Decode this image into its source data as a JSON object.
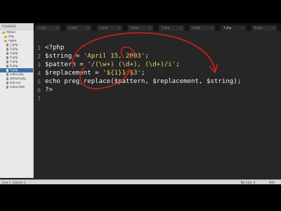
{
  "sidebar": {
    "header": "FOLDERS",
    "items": [
      {
        "label": "htdocs",
        "type": "folder"
      },
      {
        "label": "img",
        "type": "folder"
      },
      {
        "label": "regex",
        "type": "folder"
      },
      {
        "label": "1.php",
        "type": "file"
      },
      {
        "label": "2.php",
        "type": "file"
      },
      {
        "label": "3.php",
        "type": "file"
      },
      {
        "label": "4.php",
        "type": "file"
      },
      {
        "label": "5.php",
        "type": "file"
      },
      {
        "label": "6.php",
        "type": "file"
      },
      {
        "label": "7.php",
        "type": "file",
        "selected": true
      },
      {
        "label": "index.php",
        "type": "file"
      },
      {
        "label": "default.php",
        "type": "file"
      },
      {
        "label": "test.css",
        "type": "file"
      },
      {
        "label": "index.html",
        "type": "file"
      }
    ]
  },
  "tabs": [
    {
      "label": "1.php"
    },
    {
      "label": "2.php"
    },
    {
      "label": "3.php"
    },
    {
      "label": "4.php"
    },
    {
      "label": "5.php"
    },
    {
      "label": "6.php"
    },
    {
      "label": "7.php",
      "active": true
    },
    {
      "label": "8.php"
    }
  ],
  "editor": {
    "line_numbers": [
      "1",
      "2",
      "3",
      "4",
      "5",
      "6",
      "7"
    ],
    "lines": [
      [
        {
          "t": "<?php",
          "c": "k"
        }
      ],
      [
        {
          "t": "$string",
          "c": "v"
        },
        {
          "t": " = ",
          "c": "o"
        },
        {
          "t": "'April 15, 2003'",
          "c": "s"
        },
        {
          "t": ";",
          "c": "o"
        }
      ],
      [
        {
          "t": "$pattern",
          "c": "v"
        },
        {
          "t": " = ",
          "c": "o"
        },
        {
          "t": "'/(\\w+) (\\d+), (\\d+)/i'",
          "c": "s"
        },
        {
          "t": ";",
          "c": "o"
        }
      ],
      [
        {
          "t": "$replacement",
          "c": "v"
        },
        {
          "t": " = ",
          "c": "o"
        },
        {
          "t": "'${1}1,$3'",
          "c": "s"
        },
        {
          "t": ";",
          "c": "o"
        }
      ],
      [
        {
          "t": "echo preg_replace($pattern, $replacement, $string);",
          "c": "k"
        }
      ],
      [
        {
          "t": "?>",
          "c": "k"
        }
      ],
      [
        {
          "t": "",
          "c": "k"
        }
      ]
    ]
  },
  "status": {
    "left": "Line 7, Column 1",
    "right1": "Tab Size: 4",
    "right2": "PHP"
  },
  "annotation_color": "#d42020"
}
